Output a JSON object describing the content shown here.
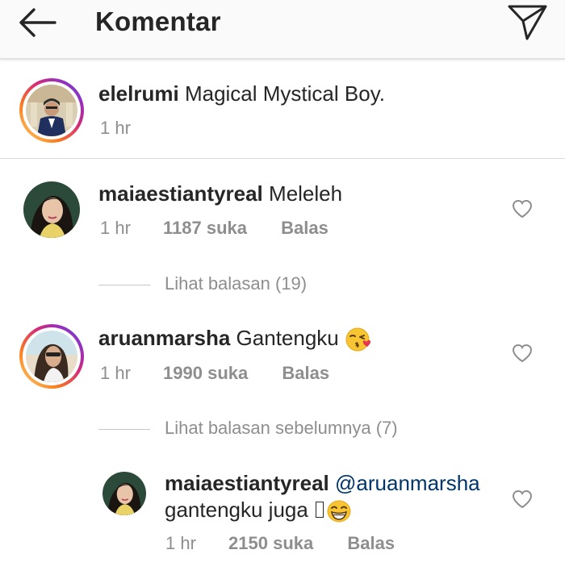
{
  "header": {
    "title": "Komentar",
    "back_icon": "arrow-left-icon",
    "send_icon": "paper-plane-icon"
  },
  "caption": {
    "username": "elelrumi",
    "text": "Magical Mystical Boy.",
    "time": "1 hr"
  },
  "comments": [
    {
      "username": "maiaestiantyreal",
      "text": "Meleleh",
      "time": "1 hr",
      "likes": "1187 suka",
      "reply_label": "Balas",
      "view_replies": "Lihat balasan (19)"
    },
    {
      "username": "aruanmarsha",
      "text": "Gantengku",
      "emoji": "face-blowing-kiss",
      "time": "1 hr",
      "likes": "1990 suka",
      "reply_label": "Balas",
      "view_replies": "Lihat balasan sebelumnya (7)",
      "replies": [
        {
          "username": "maiaestiantyreal",
          "mention": "@aruanmarsha",
          "text": "gantengku juga",
          "emoji": "grinning-face-with-smiling-eyes",
          "time": "1 hr",
          "likes": "2150 suka",
          "reply_label": "Balas"
        }
      ]
    }
  ],
  "colors": {
    "text": "#262626",
    "muted": "#8e8e8e",
    "mention": "#003569",
    "header_bg": "#fafafa"
  }
}
